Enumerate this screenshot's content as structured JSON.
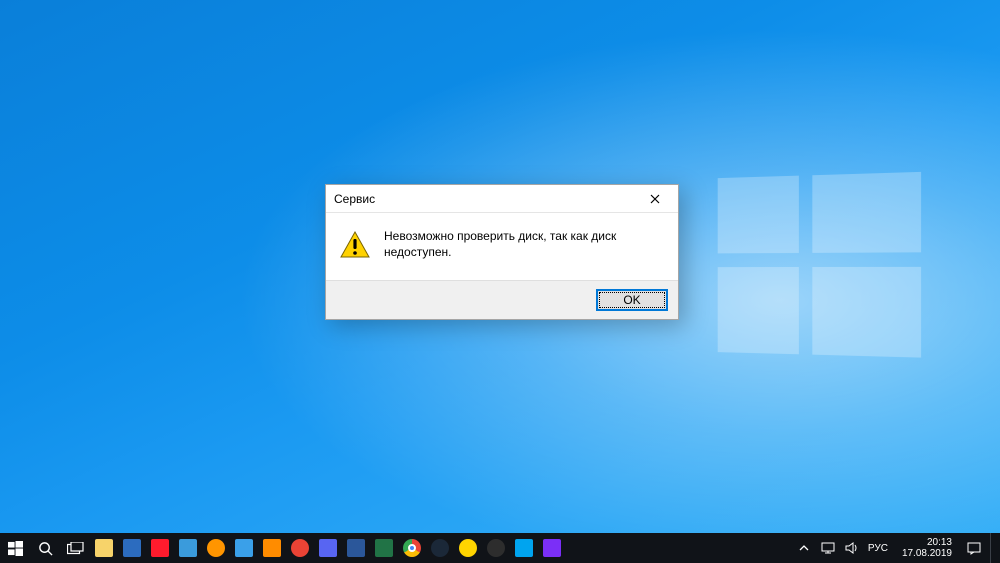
{
  "dialog": {
    "title": "Сервис",
    "message": "Невозможно проверить диск, так как диск недоступен.",
    "ok_label": "OK"
  },
  "tray": {
    "lang": "РУС",
    "time": "20:13",
    "date": "17.08.2019"
  }
}
